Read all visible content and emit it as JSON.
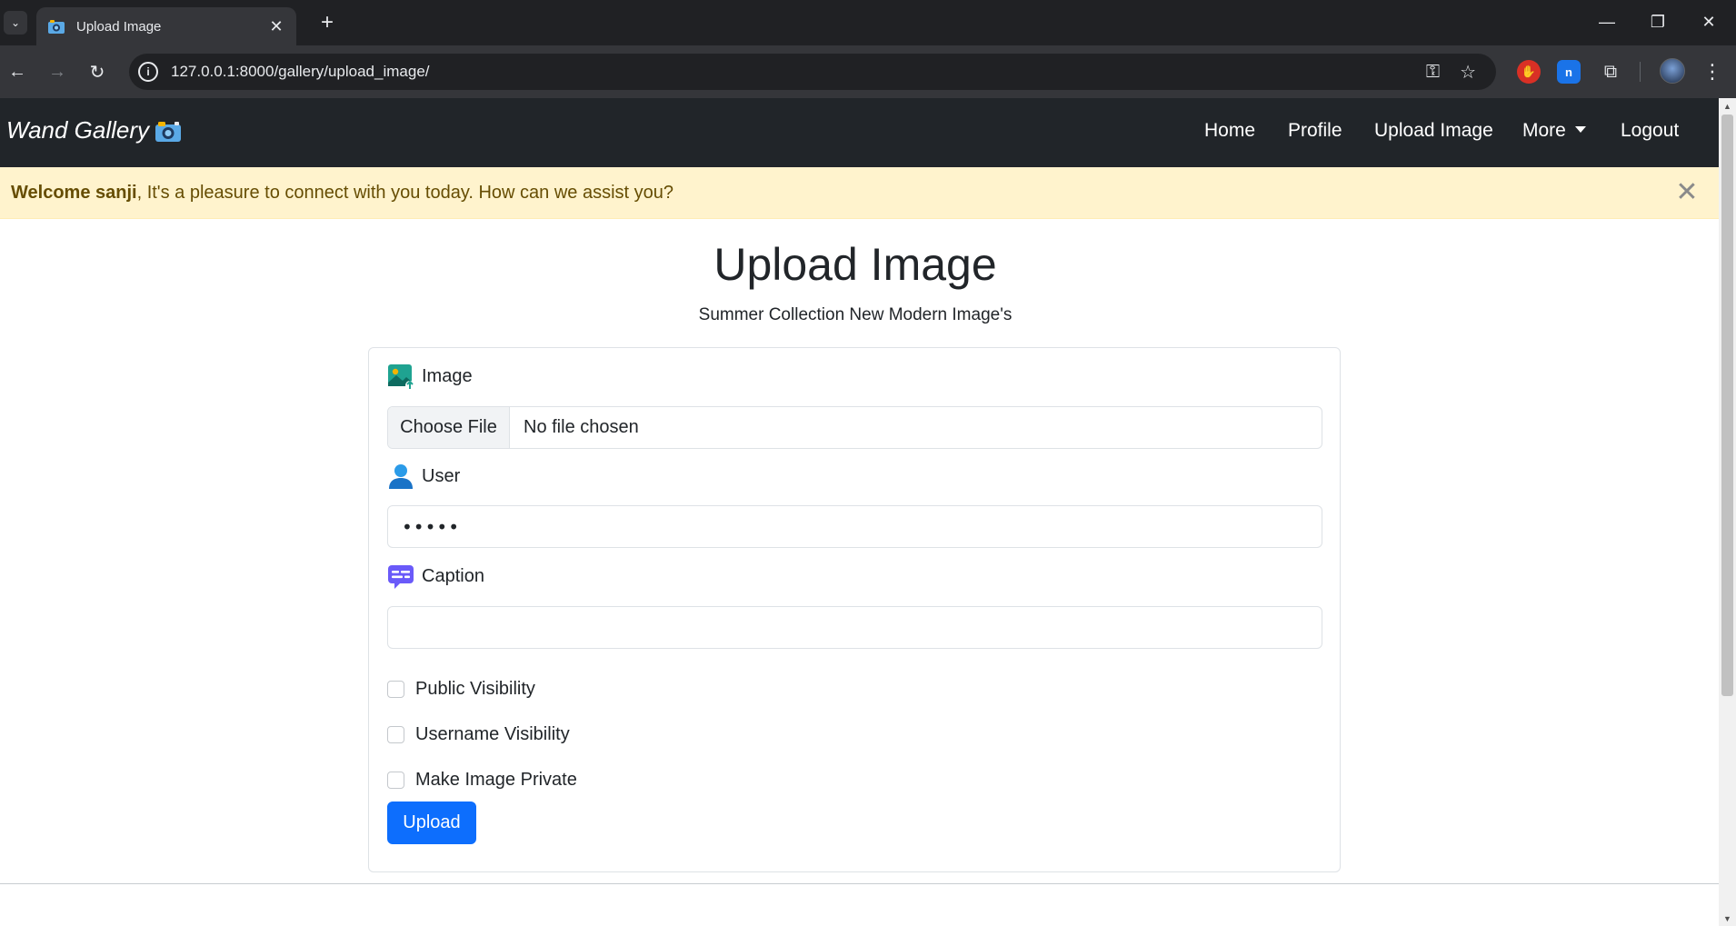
{
  "browser": {
    "tab_title": "Upload Image",
    "tab_close": "✕",
    "new_tab": "+",
    "url": "127.0.0.1:8000/gallery/upload_image/",
    "window_minimize": "—",
    "window_restore": "❐",
    "window_close": "✕"
  },
  "site": {
    "brand": "Wand Gallery",
    "nav": {
      "home": "Home",
      "profile": "Profile",
      "upload_image": "Upload Image",
      "more": "More",
      "logout": "Logout"
    }
  },
  "alert": {
    "welcome": "Welcome sanji",
    "message": ", It's a pleasure to connect with you today. How can we assist you?",
    "close": "✕"
  },
  "page": {
    "title": "Upload Image",
    "subtitle": "Summer Collection New Modern Image's"
  },
  "form": {
    "image_label": "Image",
    "choose_file": "Choose File",
    "file_status": "No file chosen",
    "user_label": "User",
    "user_value": "•••••",
    "caption_label": "Caption",
    "caption_value": "",
    "public_visibility": "Public Visibility",
    "username_visibility": "Username Visibility",
    "make_private": "Make Image Private",
    "submit": "Upload"
  },
  "colors": {
    "navbar": "#212529",
    "alert_bg": "#fff3cd",
    "alert_text": "#664d03",
    "primary": "#0d6efd"
  }
}
